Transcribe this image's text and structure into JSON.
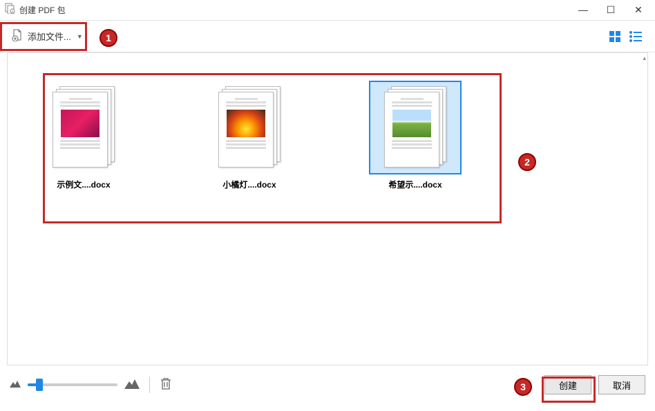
{
  "window": {
    "title": "创建 PDF 包"
  },
  "toolbar": {
    "add_files_label": "添加文件..."
  },
  "files": [
    {
      "name": "示例文....docx",
      "selected": false,
      "imgClass": "img-pink"
    },
    {
      "name": "小橘灯....docx",
      "selected": false,
      "imgClass": "img-fire"
    },
    {
      "name": "希望示....docx",
      "selected": true,
      "imgClass": "img-field"
    }
  ],
  "footer": {
    "create_label": "创建",
    "cancel_label": "取消"
  },
  "annotations": {
    "n1": "1",
    "n2": "2",
    "n3": "3"
  }
}
